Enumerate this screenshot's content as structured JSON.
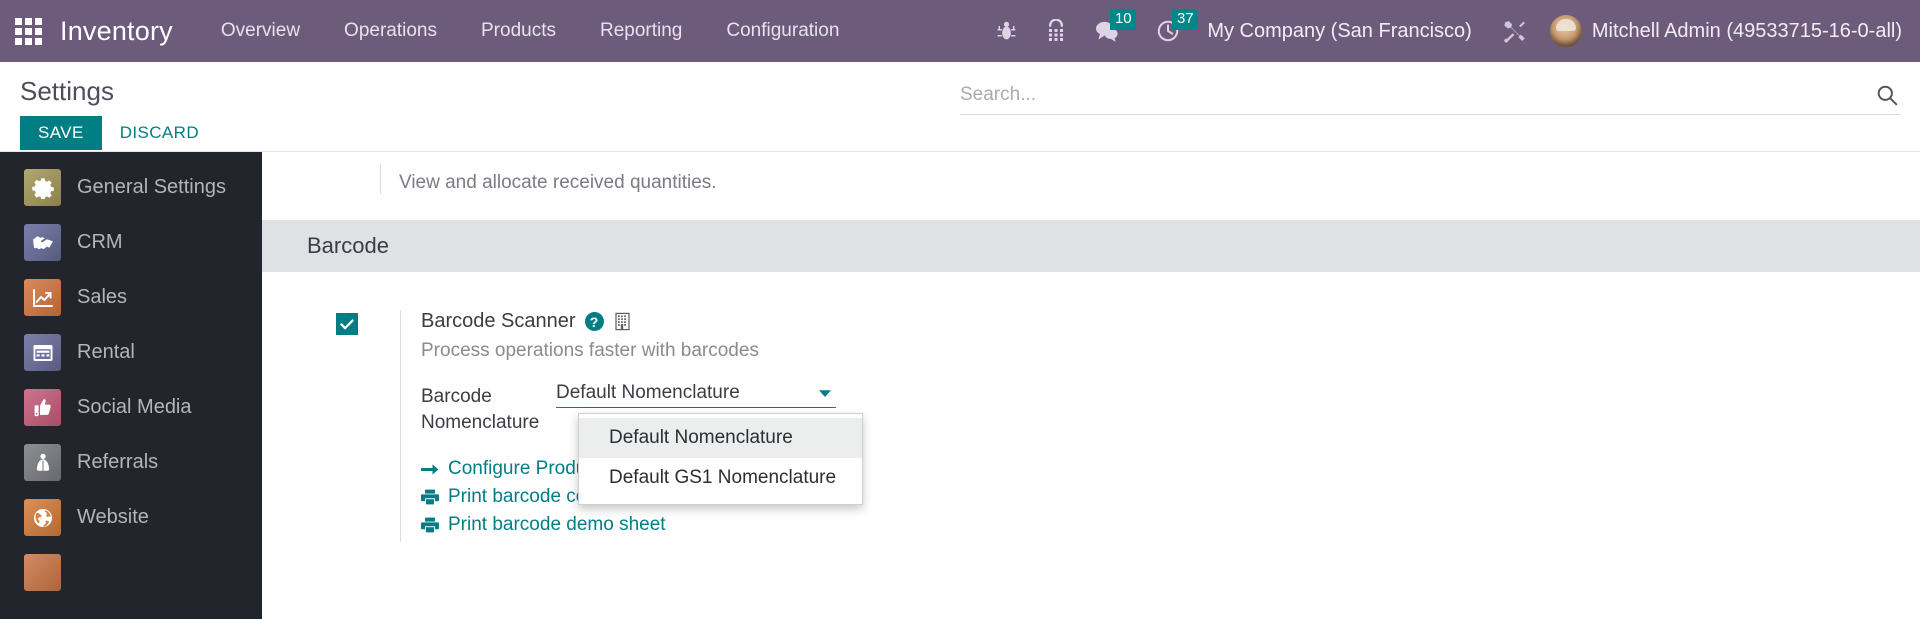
{
  "navbar": {
    "apps_icon": "apps-grid-icon",
    "brand": "Inventory",
    "menu": [
      {
        "label": "Overview"
      },
      {
        "label": "Operations"
      },
      {
        "label": "Products"
      },
      {
        "label": "Reporting"
      },
      {
        "label": "Configuration"
      }
    ],
    "icons": [
      {
        "name": "bug-icon",
        "badge": null
      },
      {
        "name": "dialpad-icon",
        "badge": null
      },
      {
        "name": "messages-icon",
        "badge": "10"
      },
      {
        "name": "activities-clock-icon",
        "badge": "37"
      }
    ],
    "company": "My Company (San Francisco)",
    "tools_icon": "tools-icon",
    "user": "Mitchell Admin (49533715-16-0-all)",
    "avatar": "user-avatar"
  },
  "control_panel": {
    "title": "Settings",
    "save_label": "SAVE",
    "discard_label": "DISCARD",
    "search_placeholder": "Search...",
    "search_value": "",
    "search_icon": "search-icon"
  },
  "sidebar": {
    "items": [
      {
        "label": "General Settings",
        "icon": "gear-icon",
        "color": "#a89c5d"
      },
      {
        "label": "CRM",
        "icon": "handshake-icon",
        "color": "#6a6f9e"
      },
      {
        "label": "Sales",
        "icon": "chart-up-icon",
        "color": "#d87a44"
      },
      {
        "label": "Rental",
        "icon": "calendar-icon",
        "color": "#6d6f9e"
      },
      {
        "label": "Social Media",
        "icon": "thumbs-up-icon",
        "color": "#c9607f"
      },
      {
        "label": "Referrals",
        "icon": "referral-person-icon",
        "color": "#7e8086"
      },
      {
        "label": "Website",
        "icon": "globe-icon",
        "color": "#d9803f"
      },
      {
        "label": "",
        "icon": "partial-icon",
        "color": "#d07b4a"
      }
    ]
  },
  "main": {
    "partial_setting_text": "View and allocate received quantities.",
    "section_title": "Barcode",
    "barcode_scanner": {
      "checked": true,
      "title": "Barcode Scanner",
      "help_icon": "?",
      "company_icon": "company-building-icon",
      "description": "Process operations faster with barcodes"
    },
    "nomenclature_field": {
      "label": "Barcode Nomenclature",
      "value": "Default Nomenclature",
      "caret_icon": "chevron-down-icon",
      "options": [
        {
          "label": "Default Nomenclature",
          "active": true
        },
        {
          "label": "Default GS1 Nomenclature",
          "active": false
        }
      ]
    },
    "links": [
      {
        "label": "Configure Product Barcodes",
        "icon": "arrow-right-icon"
      },
      {
        "label": "Print barcode commands",
        "icon": "printer-icon"
      },
      {
        "label": "Print barcode demo sheet",
        "icon": "printer-icon"
      }
    ]
  },
  "colors": {
    "navbar_bg": "#6d5b7b",
    "accent_teal": "#017e84",
    "sidebar_bg": "#23252d",
    "section_header_bg": "#dfe1e5"
  }
}
